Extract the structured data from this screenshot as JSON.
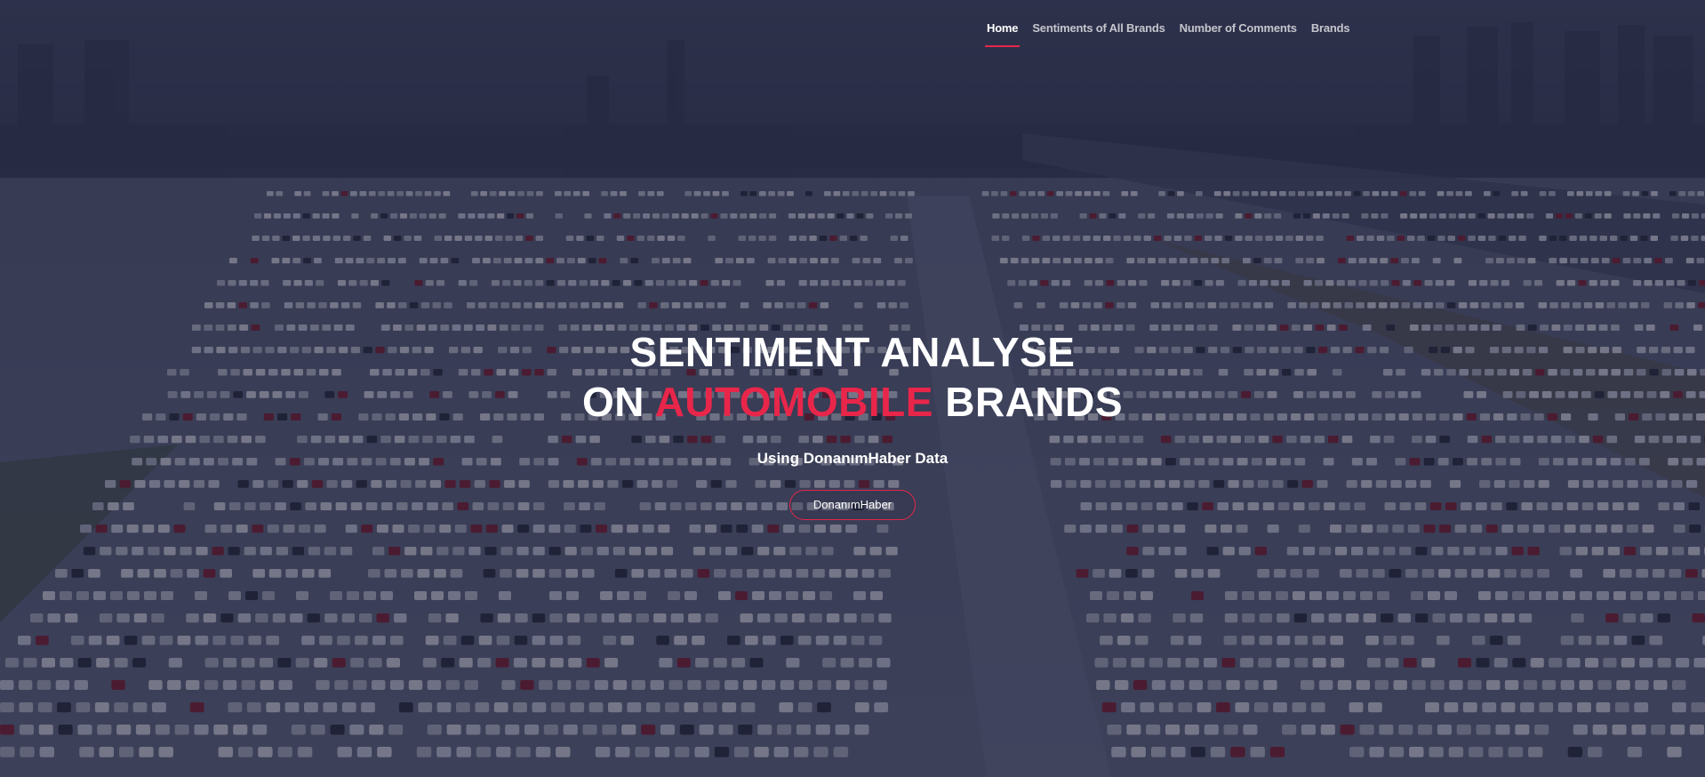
{
  "nav": {
    "items": [
      {
        "label": "Home",
        "active": true
      },
      {
        "label": "Sentiments of All Brands",
        "active": false
      },
      {
        "label": "Number of Comments",
        "active": false
      },
      {
        "label": "Brands",
        "active": false
      }
    ]
  },
  "hero": {
    "title_line1": "SENTIMENT ANALYSE",
    "title_line2_prefix": "ON",
    "title_line2_accent": "AUTOMOBILE",
    "title_line2_suffix": "BRANDS",
    "subtitle": "Using DonanımHaber Data",
    "button_label": "DonanımHaber",
    "background_image": "aerial-car-parking-lot"
  },
  "colors": {
    "accent": "#e8264a",
    "overlay": "#181a34"
  }
}
